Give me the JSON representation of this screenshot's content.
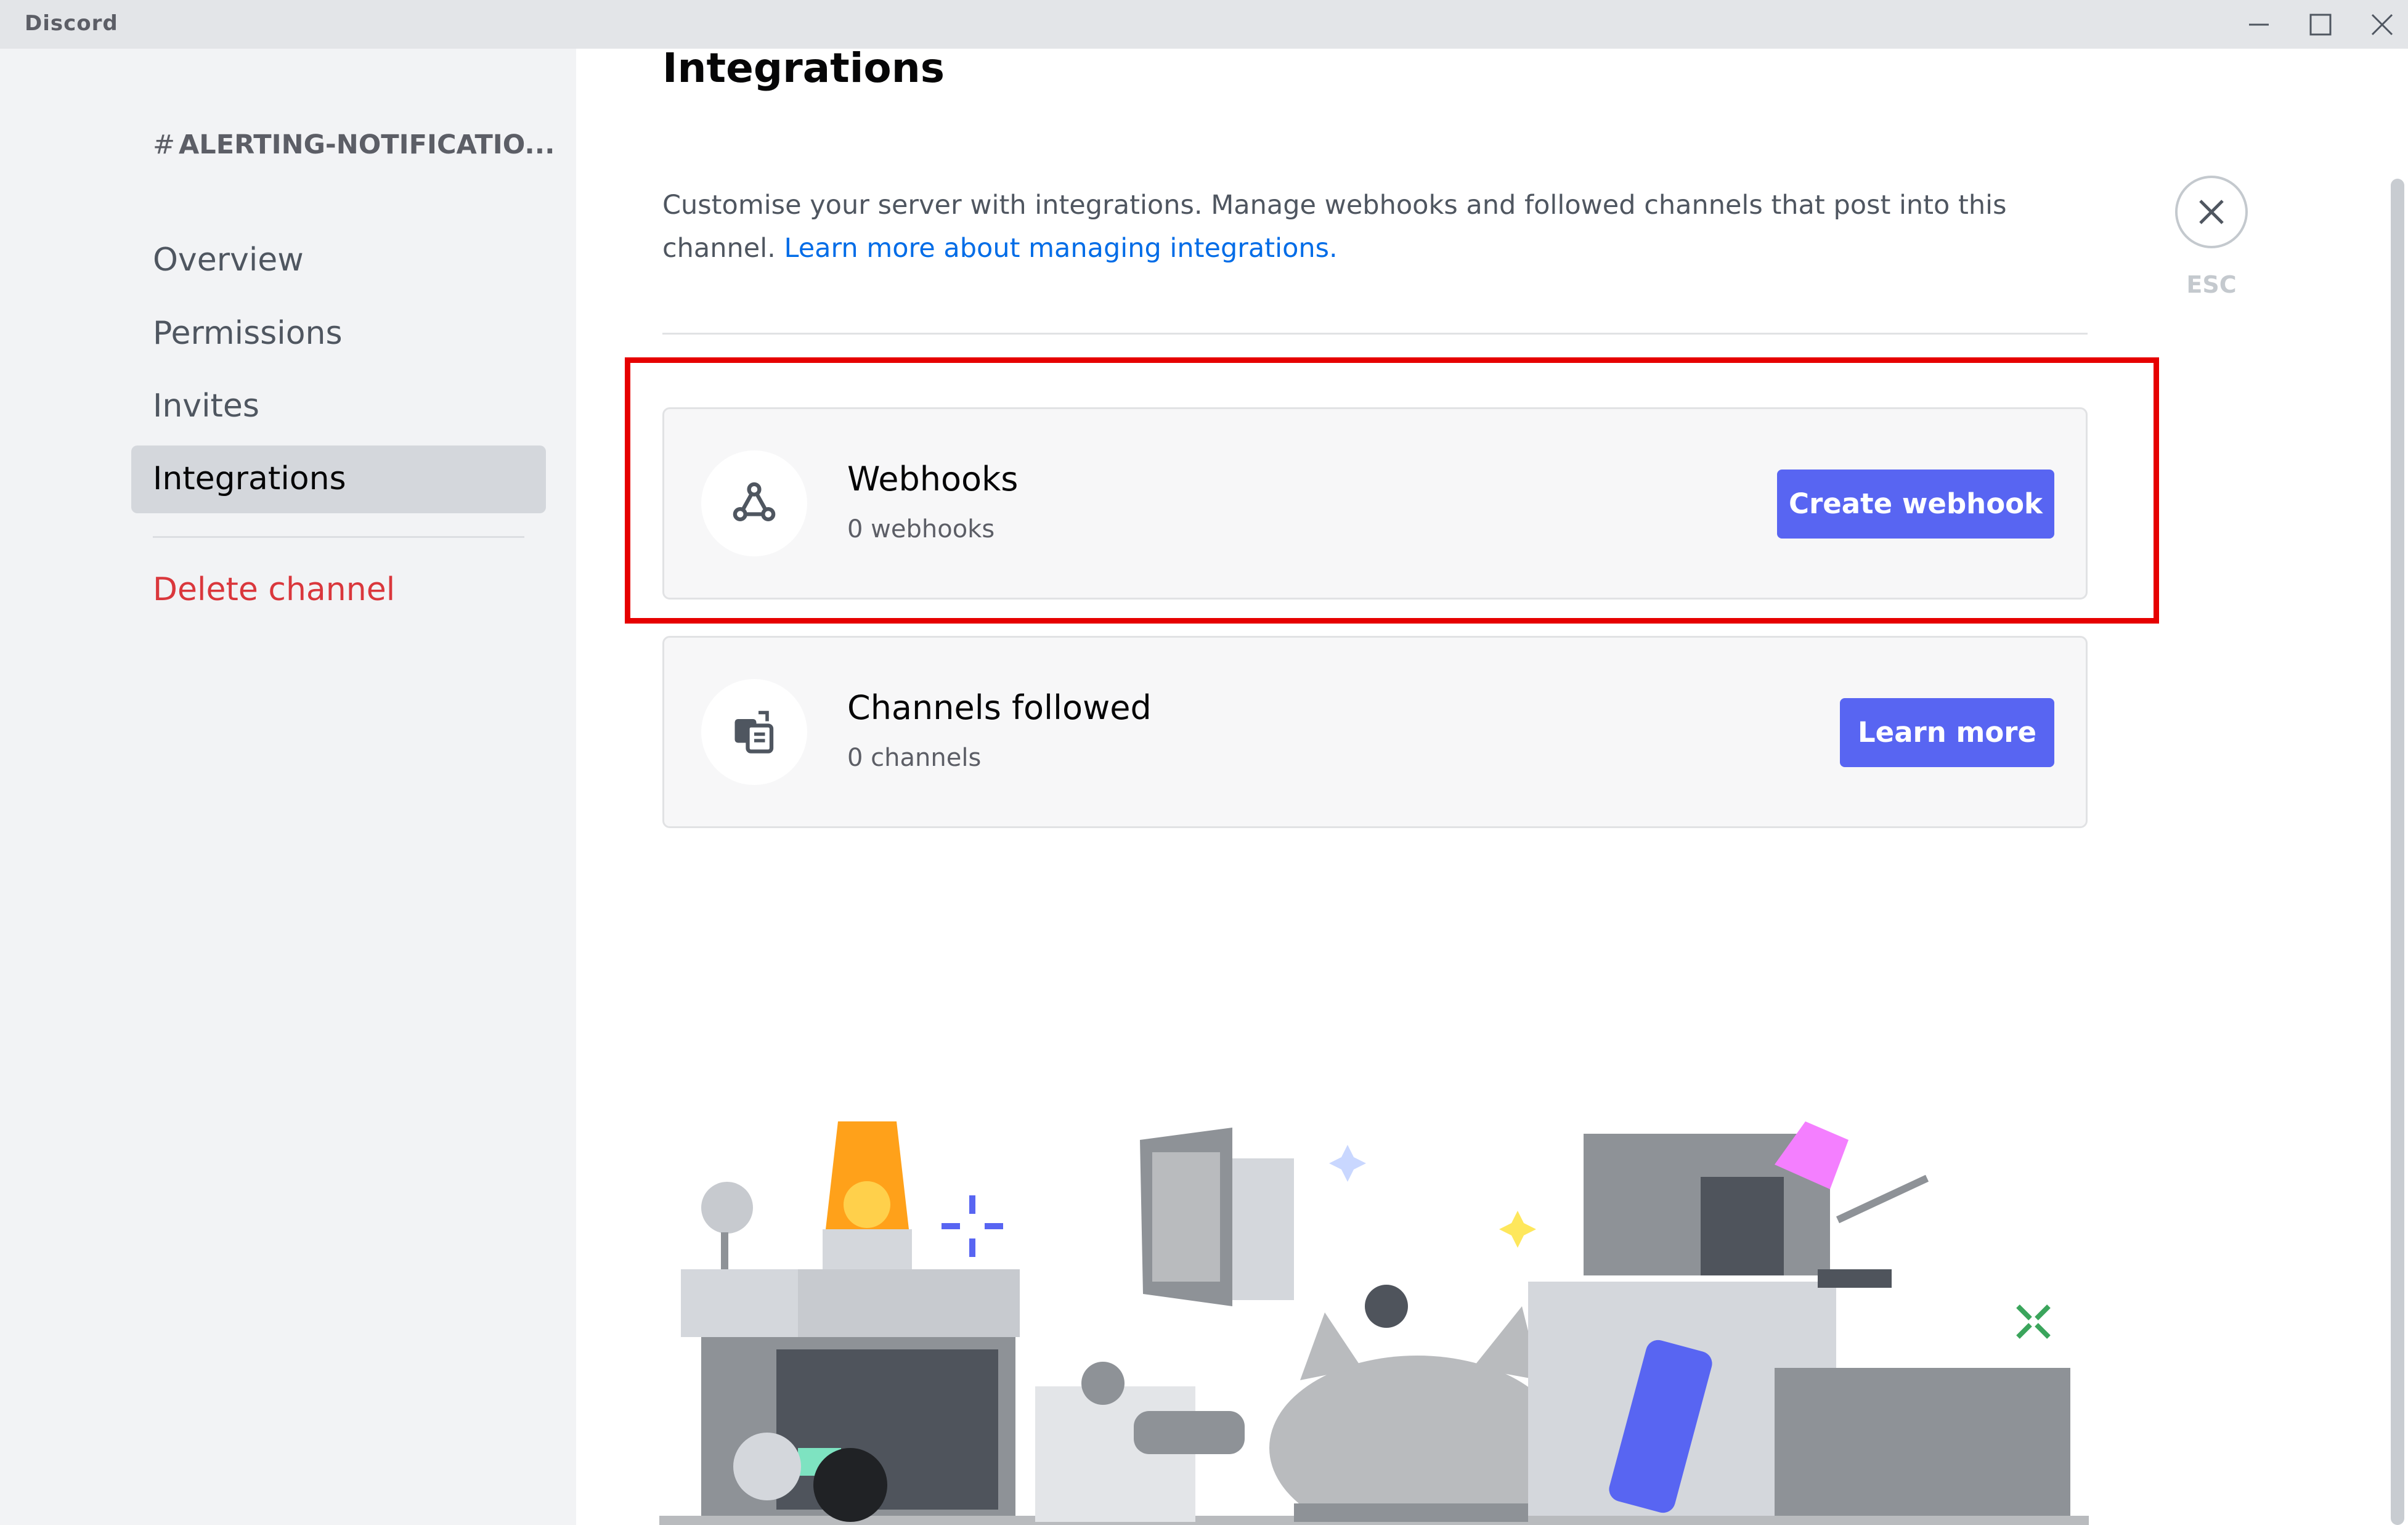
{
  "app": {
    "title": "Discord"
  },
  "window_controls": {
    "minimize": "minimize-icon",
    "maximize": "maximize-icon",
    "close": "close-icon"
  },
  "sidebar": {
    "channel_header": "ALERTING-NOTIFICATIO...",
    "channel_prefix": "#",
    "items": [
      {
        "label": "Overview"
      },
      {
        "label": "Permissions"
      },
      {
        "label": "Invites"
      },
      {
        "label": "Integrations",
        "selected": true
      }
    ],
    "danger_item": {
      "label": "Delete channel"
    }
  },
  "main": {
    "title": "Integrations",
    "description": "Customise your server with integrations. Manage webhooks and followed channels that post into this channel.",
    "learn_more_link": "Learn more about managing integrations.",
    "close_label": "ESC",
    "cards": [
      {
        "title": "Webhooks",
        "subtitle": "0 webhooks",
        "button": "Create webhook",
        "icon": "webhook-icon"
      },
      {
        "title": "Channels followed",
        "subtitle": "0 channels",
        "button": "Learn more",
        "icon": "channel-follow-icon"
      }
    ]
  },
  "colors": {
    "accent": "#5865f2",
    "danger": "#da373c",
    "link": "#006ce7",
    "highlight_box": "#e60000",
    "sidebar_bg": "#f2f3f5"
  }
}
